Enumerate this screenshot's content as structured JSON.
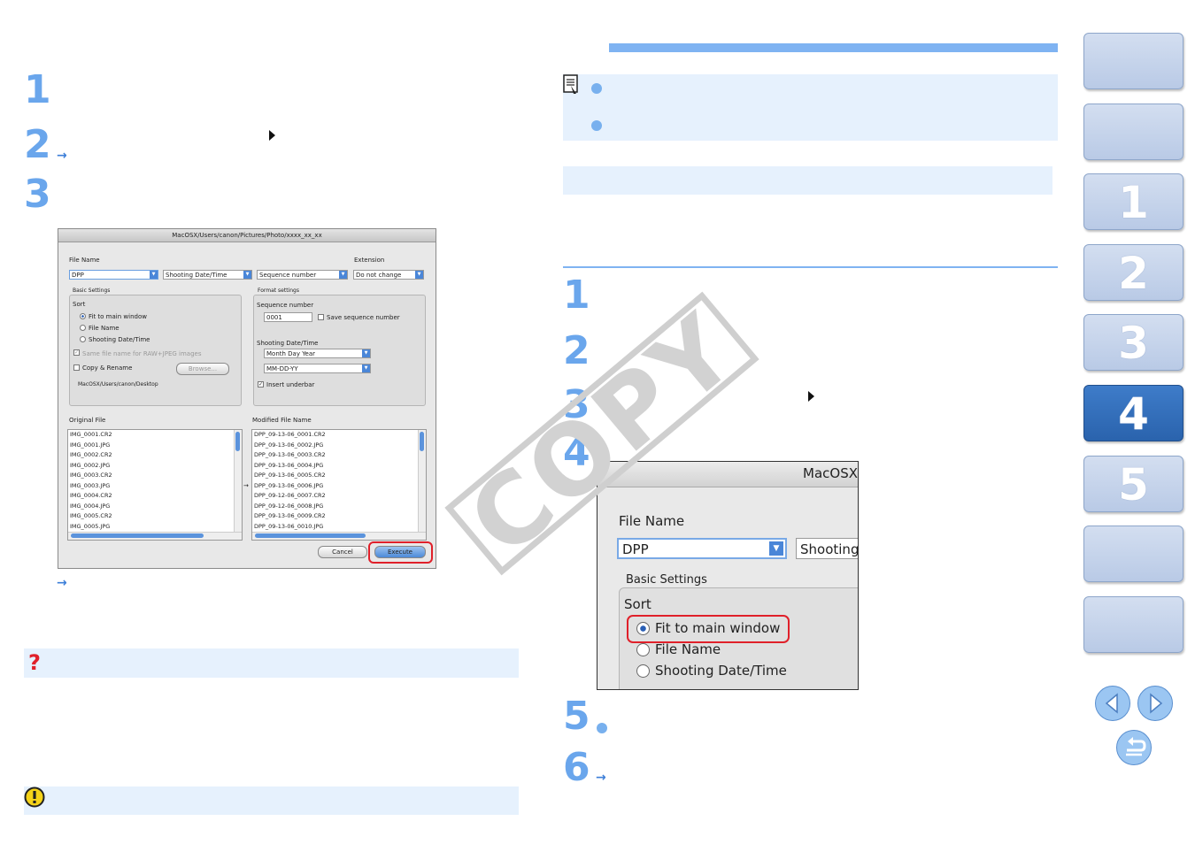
{
  "left_steps": [
    "1",
    "2",
    "3"
  ],
  "right_steps": [
    "1",
    "2",
    "3",
    "4",
    "5",
    "6"
  ],
  "dialog": {
    "title": "MacOSX/Users/canon/Pictures/Photo/xxxx_xx_xx",
    "file_name_label": "File Name",
    "extension_label": "Extension",
    "file_name_value": "DPP",
    "field2": "Shooting Date/Time",
    "field3": "Sequence number",
    "extension_value": "Do not change",
    "basic_settings_label": "Basic Settings",
    "sort_label": "Sort",
    "sort_options": [
      "Fit to main window",
      "File Name",
      "Shooting Date/Time"
    ],
    "same_file_name": "Same file name for RAW+JPEG images",
    "copy_rename": "Copy & Rename",
    "browse": "Browse...",
    "dest_path": "MacOSX/Users/canon/Desktop",
    "format_settings_label": "Format settings",
    "sequence_number_label": "Sequence number",
    "sequence_value": "0001",
    "save_sequence": "Save sequence number",
    "shooting_dt_label": "Shooting Date/Time",
    "date_order": "Month Day Year",
    "date_format": "MM-DD-YY",
    "insert_underbar": "Insert underbar",
    "original_file_label": "Original File",
    "modified_file_label": "Modified File Name",
    "original_files": [
      "IMG_0001.CR2",
      "IMG_0001.JPG",
      "IMG_0002.CR2",
      "IMG_0002.JPG",
      "IMG_0003.CR2",
      "IMG_0003.JPG",
      "IMG_0004.CR2",
      "IMG_0004.JPG",
      "IMG_0005.CR2",
      "IMG_0005.JPG"
    ],
    "modified_files": [
      "DPP_09-13-06_0001.CR2",
      "DPP_09-13-06_0002.JPG",
      "DPP_09-13-06_0003.CR2",
      "DPP_09-13-06_0004.JPG",
      "DPP_09-13-06_0005.CR2",
      "DPP_09-13-06_0006.JPG",
      "DPP_09-12-06_0007.CR2",
      "DPP_09-12-06_0008.JPG",
      "DPP_09-13-06_0009.CR2",
      "DPP_09-13-06_0010.JPG"
    ],
    "cancel": "Cancel",
    "execute": "Execute"
  },
  "zoom": {
    "title": "MacOSX",
    "file_name_label": "File Name",
    "file_name_value": "DPP",
    "field2": "Shooting",
    "basic_settings_label": "Basic Settings",
    "sort_label": "Sort",
    "sort_options": [
      "Fit to main window",
      "File Name",
      "Shooting Date/Time"
    ]
  },
  "watermark": "COPY",
  "nav": {
    "chapters": [
      "1",
      "2",
      "3",
      "4",
      "5"
    ],
    "active": "4"
  },
  "colors": {
    "accent": "#6aa6ec",
    "band": "#e6f1fd",
    "highlight_red": "#e0202a",
    "nav_active": "#2f6bb7"
  }
}
